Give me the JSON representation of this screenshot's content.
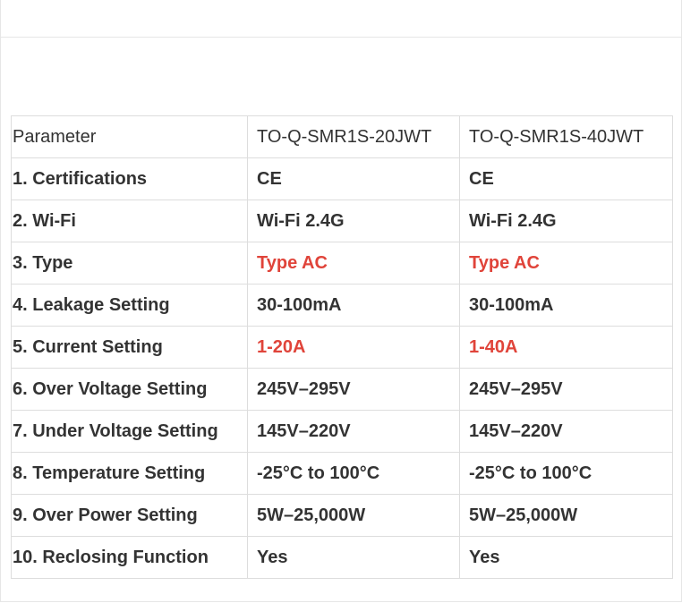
{
  "table": {
    "header": {
      "parameter": "Parameter",
      "model_1": "TO-Q-SMR1S-20JWT",
      "model_2": "TO-Q-SMR1S-40JWT"
    },
    "rows": [
      {
        "parameter": "1. Certifications",
        "model_1": "CE",
        "model_2": "CE",
        "highlight": false
      },
      {
        "parameter": "2. Wi-Fi",
        "model_1": "Wi-Fi 2.4G",
        "model_2": "Wi-Fi 2.4G",
        "highlight": false
      },
      {
        "parameter": "3. Type",
        "model_1": "Type AC",
        "model_2": "Type AC",
        "highlight": true
      },
      {
        "parameter": "4. Leakage Setting",
        "model_1": "30-100mA",
        "model_2": "30-100mA",
        "highlight": false
      },
      {
        "parameter": "5. Current Setting",
        "model_1": "1-20A",
        "model_2": "1-40A",
        "highlight": true
      },
      {
        "parameter": "6. Over Voltage Setting",
        "model_1": "245V–295V",
        "model_2": "245V–295V",
        "highlight": false
      },
      {
        "parameter": "7. Under Voltage Setting",
        "model_1": "145V–220V",
        "model_2": "145V–220V",
        "highlight": false
      },
      {
        "parameter": "8. Temperature Setting",
        "model_1": "-25°C to 100°C",
        "model_2": "-25°C to 100°C",
        "highlight": false
      },
      {
        "parameter": "9. Over Power Setting",
        "model_1": "5W–25,000W",
        "model_2": "5W–25,000W",
        "highlight": false
      },
      {
        "parameter": "10. Reclosing Function",
        "model_1": "Yes",
        "model_2": "Yes",
        "highlight": false
      }
    ]
  },
  "colors": {
    "highlight": "#e0443a",
    "text": "#333333",
    "border": "#dddddd"
  }
}
